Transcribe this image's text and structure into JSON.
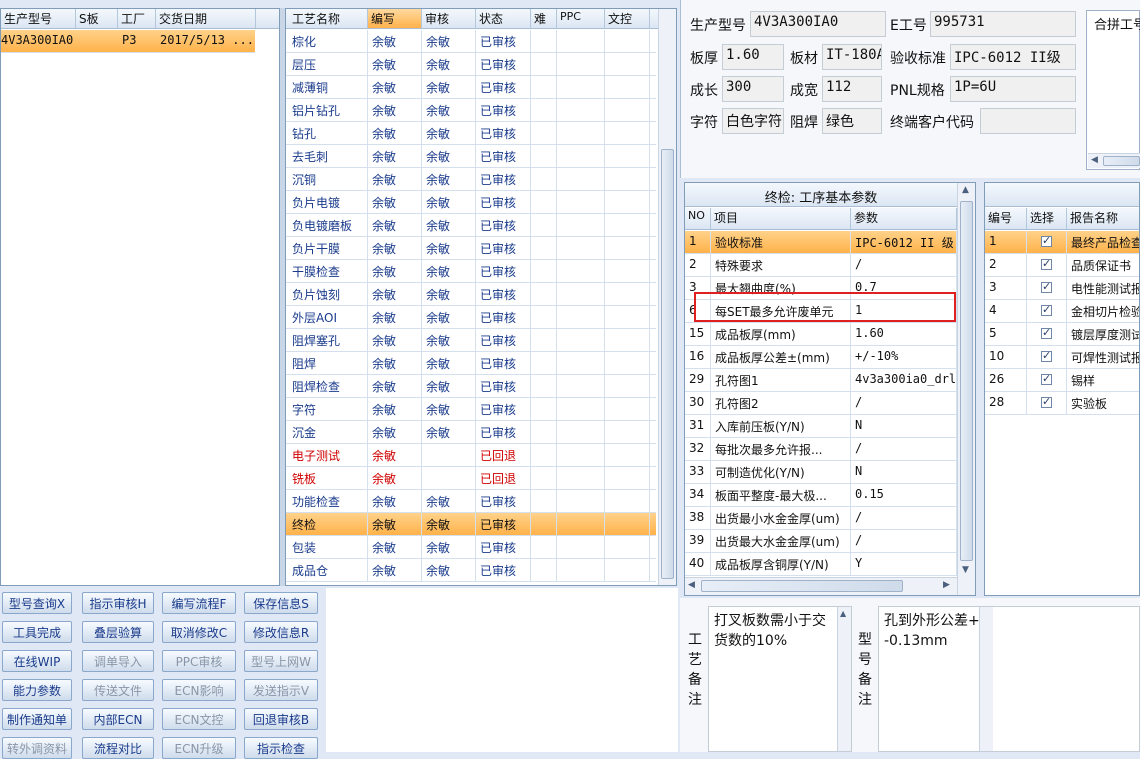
{
  "left_grid": {
    "headers": [
      "生产型号",
      "S板",
      "工厂",
      "交货日期"
    ],
    "rows": [
      [
        "4V3A300IA0",
        "",
        "P3",
        "2017/5/13 ..."
      ]
    ]
  },
  "process_grid": {
    "headers": [
      "工艺名称",
      "编写",
      "审核",
      "状态",
      "难",
      "PPC",
      "文控"
    ],
    "rows": [
      {
        "name": "棕化",
        "writer": "余敏",
        "reviewer": "余敏",
        "status": "已审核",
        "red": false
      },
      {
        "name": "层压",
        "writer": "余敏",
        "reviewer": "余敏",
        "status": "已审核",
        "red": false
      },
      {
        "name": "减薄铜",
        "writer": "余敏",
        "reviewer": "余敏",
        "status": "已审核",
        "red": false
      },
      {
        "name": "铝片钻孔",
        "writer": "余敏",
        "reviewer": "余敏",
        "status": "已审核",
        "red": false
      },
      {
        "name": "钻孔",
        "writer": "余敏",
        "reviewer": "余敏",
        "status": "已审核",
        "red": false
      },
      {
        "name": "去毛刺",
        "writer": "余敏",
        "reviewer": "余敏",
        "status": "已审核",
        "red": false
      },
      {
        "name": "沉铜",
        "writer": "余敏",
        "reviewer": "余敏",
        "status": "已审核",
        "red": false
      },
      {
        "name": "负片电镀",
        "writer": "余敏",
        "reviewer": "余敏",
        "status": "已审核",
        "red": false
      },
      {
        "name": "负电镀磨板",
        "writer": "余敏",
        "reviewer": "余敏",
        "status": "已审核",
        "red": false
      },
      {
        "name": "负片干膜",
        "writer": "余敏",
        "reviewer": "余敏",
        "status": "已审核",
        "red": false
      },
      {
        "name": "干膜检查",
        "writer": "余敏",
        "reviewer": "余敏",
        "status": "已审核",
        "red": false
      },
      {
        "name": "负片蚀刻",
        "writer": "余敏",
        "reviewer": "余敏",
        "status": "已审核",
        "red": false
      },
      {
        "name": "外层AOI",
        "writer": "余敏",
        "reviewer": "余敏",
        "status": "已审核",
        "red": false
      },
      {
        "name": "阻焊塞孔",
        "writer": "余敏",
        "reviewer": "余敏",
        "status": "已审核",
        "red": false
      },
      {
        "name": "阻焊",
        "writer": "余敏",
        "reviewer": "余敏",
        "status": "已审核",
        "red": false
      },
      {
        "name": "阻焊检查",
        "writer": "余敏",
        "reviewer": "余敏",
        "status": "已审核",
        "red": false
      },
      {
        "name": "字符",
        "writer": "余敏",
        "reviewer": "余敏",
        "status": "已审核",
        "red": false
      },
      {
        "name": "沉金",
        "writer": "余敏",
        "reviewer": "余敏",
        "status": "已审核",
        "red": false
      },
      {
        "name": "电子测试",
        "writer": "余敏",
        "reviewer": "",
        "status": "已回退",
        "red": true
      },
      {
        "name": "铣板",
        "writer": "余敏",
        "reviewer": "",
        "status": "已回退",
        "red": true
      },
      {
        "name": "功能检查",
        "writer": "余敏",
        "reviewer": "余敏",
        "status": "已审核",
        "red": false
      },
      {
        "name": "终检",
        "writer": "余敏",
        "reviewer": "余敏",
        "status": "已审核",
        "red": false,
        "selected": true
      },
      {
        "name": "包装",
        "writer": "余敏",
        "reviewer": "余敏",
        "status": "已审核",
        "red": false
      },
      {
        "name": "成品仓",
        "writer": "余敏",
        "reviewer": "余敏",
        "status": "已审核",
        "red": false
      }
    ]
  },
  "buttons": [
    {
      "label": "型号查询X",
      "enabled": true
    },
    {
      "label": "指示审核H",
      "enabled": true
    },
    {
      "label": "编写流程F",
      "enabled": true
    },
    {
      "label": "保存信息S",
      "enabled": true
    },
    {
      "label": "工具完成",
      "enabled": true
    },
    {
      "label": "叠层验算",
      "enabled": true
    },
    {
      "label": "取消修改C",
      "enabled": true
    },
    {
      "label": "修改信息R",
      "enabled": true
    },
    {
      "label": "在线WIP",
      "enabled": true
    },
    {
      "label": "调单导入",
      "enabled": false
    },
    {
      "label": "PPC审核",
      "enabled": false
    },
    {
      "label": "型号上网W",
      "enabled": false
    },
    {
      "label": "能力参数",
      "enabled": true
    },
    {
      "label": "传送文件",
      "enabled": false
    },
    {
      "label": "ECN影响",
      "enabled": false
    },
    {
      "label": "发送指示V",
      "enabled": false
    },
    {
      "label": "制作通知单",
      "enabled": true
    },
    {
      "label": "内部ECN",
      "enabled": true
    },
    {
      "label": "ECN文控",
      "enabled": false
    },
    {
      "label": "回退审核B",
      "enabled": true
    },
    {
      "label": "转外调资料",
      "enabled": false
    },
    {
      "label": "流程对比",
      "enabled": true
    },
    {
      "label": "ECN升级",
      "enabled": false
    },
    {
      "label": "指示检查",
      "enabled": true
    }
  ],
  "info": {
    "prod_model_label": "生产型号",
    "prod_model": "4V3A300IA0",
    "e_no_label": "E工号",
    "e_no": "995731",
    "thickness_label": "板厚",
    "thickness": "1.60",
    "material_label": "板材",
    "material": "IT-180A",
    "standard_label": "验收标准",
    "standard": "IPC-6012 II级",
    "length_label": "成长",
    "length": "300",
    "width_label": "成宽",
    "width": "112",
    "pnl_label": "PNL规格",
    "pnl": "1P=6U",
    "char_label": "字符",
    "char": "白色字符",
    "mask_label": "阻焊",
    "mask": "绿色",
    "customer_label": "终端客户代码",
    "customer": "",
    "combine_title": "合拼工号"
  },
  "params": {
    "title": "终检: 工序基本参数",
    "headers": [
      "NO",
      "项目",
      "参数"
    ],
    "rows": [
      [
        "1",
        "验收标准",
        "IPC-6012 II 级"
      ],
      [
        "2",
        "特殊要求",
        "/"
      ],
      [
        "3",
        "最大翘曲度(%)",
        "0.7"
      ],
      [
        "6",
        "每SET最多允许废单元",
        "1"
      ],
      [
        "15",
        "成品板厚(mm)",
        "1.60"
      ],
      [
        "16",
        "成品板厚公差±(mm)",
        "+/-10%"
      ],
      [
        "29",
        "孔符图1",
        "4v3a300ia0_drl_"
      ],
      [
        "30",
        "孔符图2",
        "/"
      ],
      [
        "31",
        "入库前压板(Y/N)",
        "N"
      ],
      [
        "32",
        "每批次最多允许报...",
        "/"
      ],
      [
        "33",
        "可制造优化(Y/N)",
        "N"
      ],
      [
        "34",
        "板面平整度-最大极...",
        "0.15"
      ],
      [
        "38",
        "出货最小水金金厚(um)",
        "/"
      ],
      [
        "39",
        "出货最大水金金厚(um)",
        "/"
      ],
      [
        "40",
        "成品板厚含铜厚(Y/N)",
        "Y"
      ]
    ]
  },
  "reports": {
    "headers": [
      "编号",
      "选择",
      "报告名称"
    ],
    "rows": [
      [
        "1",
        "最终产品检查"
      ],
      [
        "2",
        "品质保证书"
      ],
      [
        "3",
        "电性能测试报"
      ],
      [
        "4",
        "金相切片检验"
      ],
      [
        "5",
        "镀层厚度测试"
      ],
      [
        "10",
        "可焊性测试报"
      ],
      [
        "26",
        "锡样"
      ],
      [
        "28",
        "实验板"
      ]
    ]
  },
  "remarks": {
    "process_label": "工艺备注",
    "process_text": "打叉板数需小于交货数的10%",
    "model_label": "型号备注",
    "model_text": "孔到外形公差+-0.13mm"
  }
}
